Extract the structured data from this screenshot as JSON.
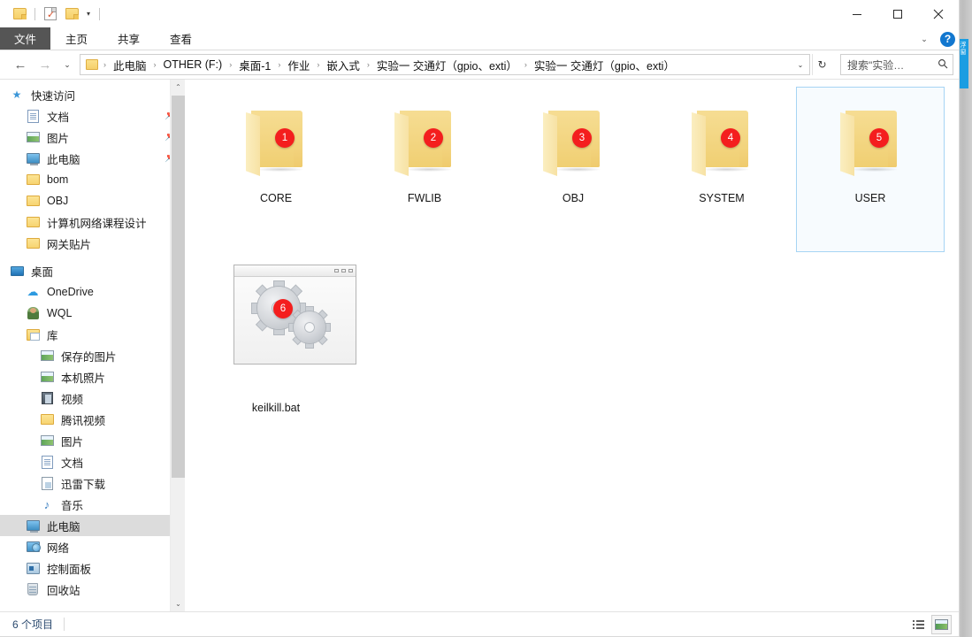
{
  "window": {
    "minimize_label": "—",
    "maximize_label": "□",
    "close_label": "✕"
  },
  "quick_access_toolbar": {
    "items": [
      {
        "name": "folder-icon",
        "label": ""
      },
      {
        "name": "properties-icon",
        "label": ""
      },
      {
        "name": "new-folder-icon",
        "label": ""
      },
      {
        "name": "customize-dropdown-icon",
        "label": "▾"
      }
    ]
  },
  "ribbon": {
    "file_tab": "文件",
    "tabs": [
      "主页",
      "共享",
      "查看"
    ],
    "expand_label": "⌄",
    "help_label": "?"
  },
  "address_bar": {
    "back_label": "←",
    "forward_label": "→",
    "recent_label": "⌄",
    "up_label": "↑",
    "breadcrumbs": [
      "此电脑",
      "OTHER (F:)",
      "桌面-1",
      "作业",
      "嵌入式",
      "实验一 交通灯（gpio、exti）",
      "实验一 交通灯（gpio、exti）"
    ],
    "separator": "›",
    "dropdown_label": "⌄",
    "refresh_label": "↻"
  },
  "search": {
    "value": "搜索\"实验…",
    "placeholder": "搜索\"实验…",
    "icon": "search-icon"
  },
  "navigation_pane": {
    "scroll_up_label": "⌃",
    "scroll_down_label": "⌄",
    "groups": [
      {
        "header": {
          "label": "快速访问",
          "icon": "star-icon",
          "indent": 0
        },
        "items": [
          {
            "label": "文档",
            "icon": "documents-icon",
            "indent": 1,
            "pinned": true
          },
          {
            "label": "图片",
            "icon": "pictures-icon",
            "indent": 1,
            "pinned": true
          },
          {
            "label": "此电脑",
            "icon": "this-pc-icon",
            "indent": 1,
            "pinned": true
          },
          {
            "label": "bom",
            "icon": "folder-icon",
            "indent": 1,
            "pinned": false
          },
          {
            "label": "OBJ",
            "icon": "folder-icon",
            "indent": 1,
            "pinned": false
          },
          {
            "label": "计算机网络课程设计",
            "icon": "folder-icon",
            "indent": 1,
            "pinned": false
          },
          {
            "label": "网关贴片",
            "icon": "folder-icon",
            "indent": 1,
            "pinned": false
          }
        ]
      },
      {
        "header": {
          "label": "桌面",
          "icon": "desktop-icon",
          "indent": 0
        },
        "items": [
          {
            "label": "OneDrive",
            "icon": "onedrive-icon",
            "indent": 1,
            "pinned": false
          },
          {
            "label": "WQL",
            "icon": "user-icon",
            "indent": 1,
            "pinned": false
          }
        ]
      },
      {
        "header": {
          "label": "库",
          "icon": "library-icon",
          "indent": 1
        },
        "items": [
          {
            "label": "保存的图片",
            "icon": "pictures-icon",
            "indent": 2,
            "pinned": false
          },
          {
            "label": "本机照片",
            "icon": "pictures-icon",
            "indent": 2,
            "pinned": false
          },
          {
            "label": "视频",
            "icon": "videos-icon",
            "indent": 2,
            "pinned": false
          },
          {
            "label": "腾讯视频",
            "icon": "folder-icon",
            "indent": 2,
            "pinned": false
          },
          {
            "label": "图片",
            "icon": "pictures-icon",
            "indent": 2,
            "pinned": false
          },
          {
            "label": "文档",
            "icon": "documents-icon",
            "indent": 2,
            "pinned": false
          },
          {
            "label": "迅雷下载",
            "icon": "downloads-icon",
            "indent": 2,
            "pinned": false
          },
          {
            "label": "音乐",
            "icon": "music-icon",
            "indent": 2,
            "pinned": false
          }
        ]
      },
      {
        "header": null,
        "items": [
          {
            "label": "此电脑",
            "icon": "this-pc-icon",
            "indent": 1,
            "pinned": false,
            "selected": true
          },
          {
            "label": "网络",
            "icon": "network-icon",
            "indent": 1,
            "pinned": false
          },
          {
            "label": "控制面板",
            "icon": "control-panel-icon",
            "indent": 1,
            "pinned": false
          },
          {
            "label": "回收站",
            "icon": "recycle-bin-icon",
            "indent": 1,
            "pinned": false
          }
        ]
      }
    ]
  },
  "file_list": {
    "items": [
      {
        "name": "CORE",
        "type": "folder",
        "badge": "1",
        "selected": false
      },
      {
        "name": "FWLIB",
        "type": "folder",
        "badge": "2",
        "selected": false
      },
      {
        "name": "OBJ",
        "type": "folder",
        "badge": "3",
        "selected": false
      },
      {
        "name": "SYSTEM",
        "type": "folder",
        "badge": "4",
        "selected": false
      },
      {
        "name": "USER",
        "type": "folder",
        "badge": "5",
        "selected": true
      },
      {
        "name": "keilkill.bat",
        "type": "batch-file",
        "badge": "6",
        "selected": false
      }
    ]
  },
  "status_bar": {
    "item_count": "6 个项目",
    "view_details_label": "",
    "view_large_icons_label": ""
  },
  "desktop": {
    "side_tab_text": "浮窗"
  },
  "colors": {
    "badge_red": "#f41e1e",
    "folder_yellow": "#f0cf72",
    "selection_blue": "#a6d4f4",
    "file_tab_gray": "#555555",
    "help_blue": "#1277cf",
    "status_text": "#2b4a6f"
  }
}
